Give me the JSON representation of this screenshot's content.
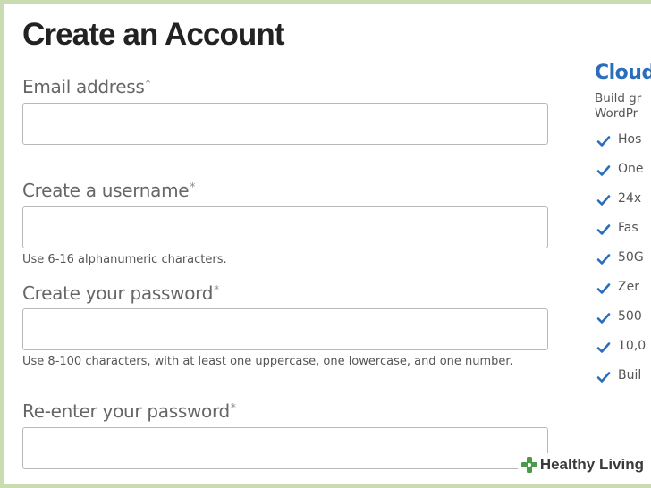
{
  "form": {
    "title": "Create an Account",
    "required_marker": "*",
    "fields": [
      {
        "label": "Email address",
        "value": "",
        "hint": ""
      },
      {
        "label": "Create a username",
        "value": "",
        "hint": "Use 6-16 alphanumeric characters."
      },
      {
        "label": "Create your password",
        "value": "",
        "hint": "Use 8-100 characters, with at least one uppercase, one lowercase, and one number."
      },
      {
        "label": "Re-enter your password",
        "value": "",
        "hint": ""
      }
    ]
  },
  "aside": {
    "title": "Cloud",
    "description_lines": [
      "Build gr",
      "WordPr"
    ],
    "items": [
      "Hos",
      "One",
      "24x",
      "Fas",
      "50G",
      "Zer",
      "500",
      "10,0",
      "Buil"
    ],
    "check_color": "#2a6ebb",
    "check_icon": "checkmark-icon"
  },
  "watermark": {
    "text": "Healthy Living",
    "logo_icon": "leaf-cross-icon",
    "logo_color": "#4a9a4a"
  },
  "colors": {
    "background": "#c9dbb0",
    "title": "#222222",
    "label": "#666666",
    "accent": "#2a6ebb"
  }
}
